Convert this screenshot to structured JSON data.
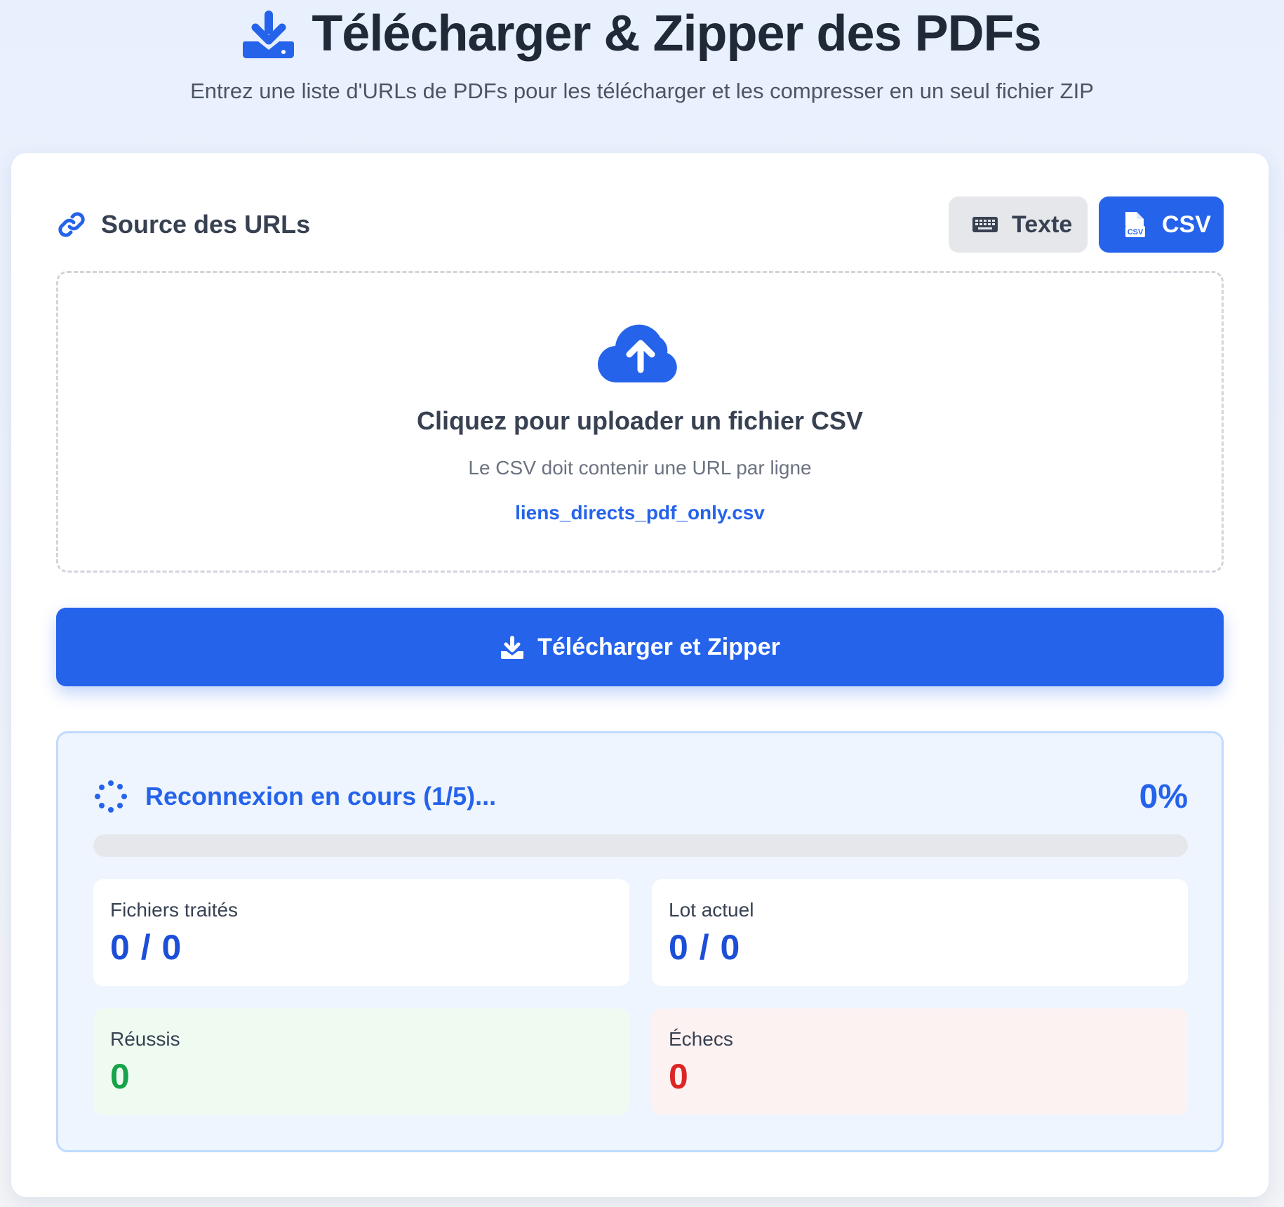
{
  "header": {
    "title": "Télécharger & Zipper des PDFs",
    "title_icon": "download-icon",
    "subtitle": "Entrez une liste d'URLs de PDFs pour les télécharger et les compresser en un seul fichier ZIP"
  },
  "source": {
    "title": "Source des URLs",
    "icon": "link-icon",
    "modes": [
      {
        "label": "Texte",
        "icon": "keyboard-icon",
        "active": false
      },
      {
        "label": "CSV",
        "icon": "csv-file-icon",
        "active": true
      }
    ]
  },
  "upload": {
    "icon": "cloud-upload-icon",
    "title": "Cliquez pour uploader un fichier CSV",
    "hint": "Le CSV doit contenir une URL par ligne",
    "filename": "liens_directs_pdf_only.csv"
  },
  "action": {
    "label": "Télécharger et Zipper",
    "icon": "download-icon"
  },
  "progress": {
    "status": "Reconnexion en cours (1/5)...",
    "percent_label": "0%",
    "percent": 0,
    "stats": {
      "processed": {
        "label": "Fichiers traités",
        "value": "0 / 0"
      },
      "batch": {
        "label": "Lot actuel",
        "value": "0 / 0"
      },
      "success": {
        "label": "Réussis",
        "value": "0"
      },
      "failures": {
        "label": "Échecs",
        "value": "0"
      }
    }
  },
  "colors": {
    "primary": "#2563eb",
    "success": "#16a34a",
    "danger": "#dc2626",
    "panel_bg": "#eef5ff"
  }
}
